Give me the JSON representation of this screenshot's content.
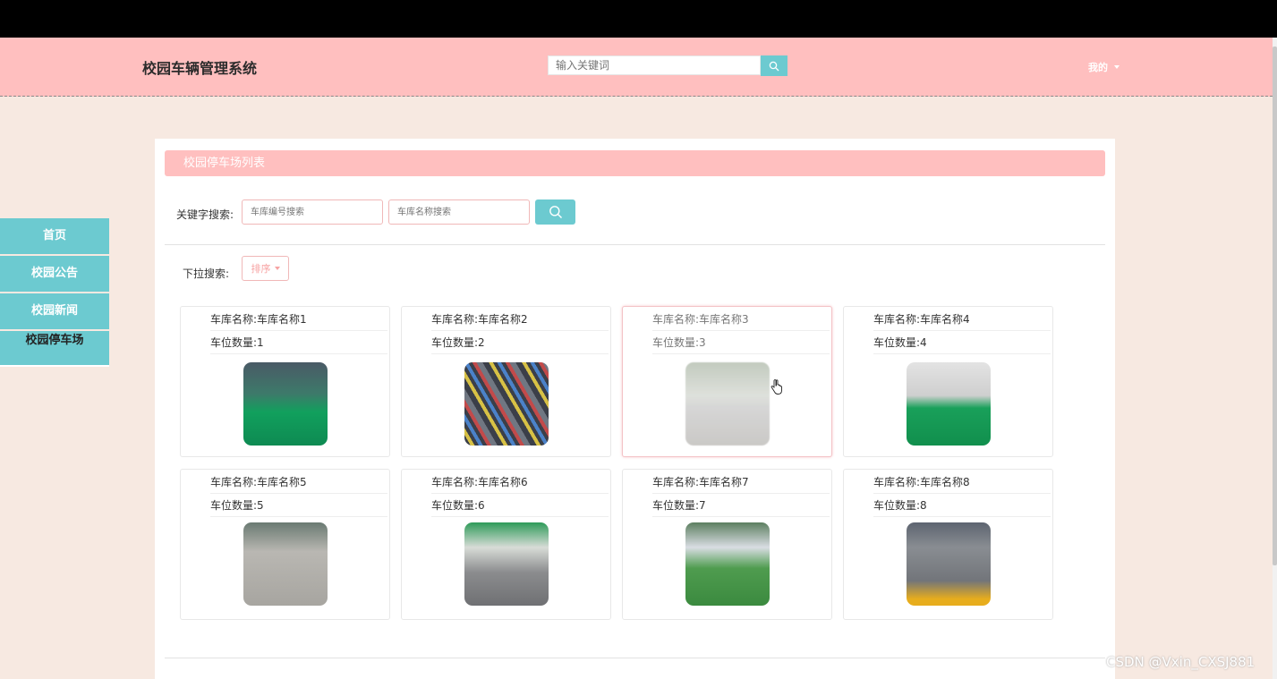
{
  "header": {
    "site_title": "校园车辆管理系统",
    "search_placeholder": "输入关键词",
    "user_menu_label": "我的"
  },
  "sidebar": {
    "items": [
      {
        "label": "首页"
      },
      {
        "label": "校园公告"
      },
      {
        "label": "校园新闻"
      },
      {
        "label": "校园停车场"
      }
    ]
  },
  "main": {
    "list_title": "校园停车场列表",
    "keyword_label": "关键字搜索:",
    "keyword_inputs": [
      {
        "placeholder": "车库编号搜索"
      },
      {
        "placeholder": "车库名称搜索"
      }
    ],
    "dropdown_label": "下拉搜索:",
    "sort_label": "排序",
    "cards": [
      {
        "name_text": "车库名称:车库名称1",
        "count_text": "车位数量:1"
      },
      {
        "name_text": "车库名称:车库名称2",
        "count_text": "车位数量:2"
      },
      {
        "name_text": "车库名称:车库名称3",
        "count_text": "车位数量:3"
      },
      {
        "name_text": "车库名称:车库名称4",
        "count_text": "车位数量:4"
      },
      {
        "name_text": "车库名称:车库名称5",
        "count_text": "车位数量:5"
      },
      {
        "name_text": "车库名称:车库名称6",
        "count_text": "车位数量:6"
      },
      {
        "name_text": "车库名称:车库名称7",
        "count_text": "车位数量:7"
      },
      {
        "name_text": "车库名称:车库名称8",
        "count_text": "车位数量:8"
      }
    ]
  },
  "watermark": "CSDN @Vxin_CXSJ881",
  "colors": {
    "header_bg": "#ffbfbf",
    "accent_teal": "#6ccad0",
    "page_bg": "#f7e9e1"
  }
}
